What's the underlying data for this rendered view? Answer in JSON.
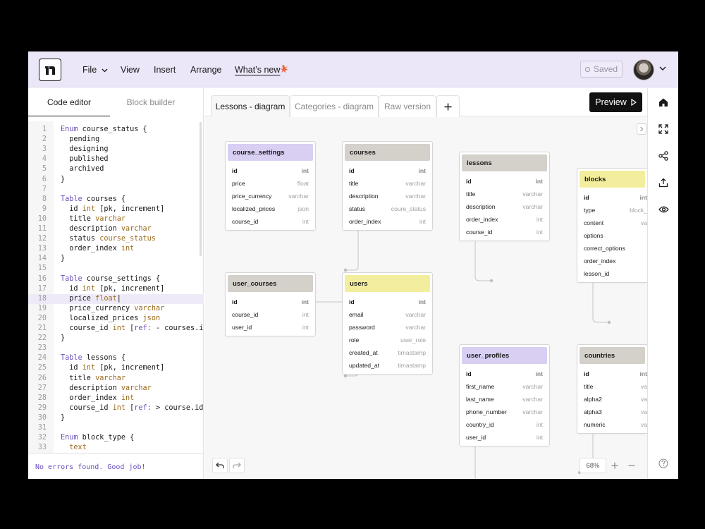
{
  "menu": {
    "file": "File",
    "view": "View",
    "insert": "Insert",
    "arrange": "Arrange",
    "whats_new": "What’s new"
  },
  "status_button": "Saved",
  "left_tabs": {
    "code": "Code editor",
    "block": "Block builder"
  },
  "code_lines": [
    [
      [
        "kw",
        "Enum"
      ],
      [
        "t",
        " course_status {"
      ]
    ],
    [
      [
        "t",
        "  pending"
      ]
    ],
    [
      [
        "t",
        "  designing"
      ]
    ],
    [
      [
        "t",
        "  published"
      ]
    ],
    [
      [
        "t",
        "  archived"
      ]
    ],
    [
      [
        "t",
        "}"
      ]
    ],
    [
      [
        "t",
        ""
      ]
    ],
    [
      [
        "kw",
        "Table"
      ],
      [
        "t",
        " courses {"
      ]
    ],
    [
      [
        "t",
        "  id "
      ],
      [
        "ty",
        "int"
      ],
      [
        "t",
        " [pk, increment]"
      ]
    ],
    [
      [
        "t",
        "  title "
      ],
      [
        "ty",
        "varchar"
      ]
    ],
    [
      [
        "t",
        "  description "
      ],
      [
        "ty",
        "varchar"
      ]
    ],
    [
      [
        "t",
        "  status "
      ],
      [
        "ty",
        "course_status"
      ]
    ],
    [
      [
        "t",
        "  order_index "
      ],
      [
        "ty",
        "int"
      ]
    ],
    [
      [
        "t",
        "}"
      ]
    ],
    [
      [
        "t",
        ""
      ]
    ],
    [
      [
        "kw",
        "Table"
      ],
      [
        "t",
        " course_settings {"
      ]
    ],
    [
      [
        "t",
        "  id "
      ],
      [
        "ty",
        "int"
      ],
      [
        "t",
        " [pk, increment]"
      ]
    ],
    [
      [
        "t",
        "  price "
      ],
      [
        "ty",
        "float"
      ],
      [
        "t",
        "|"
      ]
    ],
    [
      [
        "t",
        "  price_currency "
      ],
      [
        "ty",
        "varchar"
      ]
    ],
    [
      [
        "t",
        "  localized_prices "
      ],
      [
        "ty",
        "json"
      ]
    ],
    [
      [
        "t",
        "  course_id "
      ],
      [
        "ty",
        "int"
      ],
      [
        "t",
        " ["
      ],
      [
        "rf",
        "ref:"
      ],
      [
        "t",
        " - courses.id]"
      ]
    ],
    [
      [
        "t",
        "}"
      ]
    ],
    [
      [
        "t",
        ""
      ]
    ],
    [
      [
        "kw",
        "Table"
      ],
      [
        "t",
        " lessons {"
      ]
    ],
    [
      [
        "t",
        "  id "
      ],
      [
        "ty",
        "int"
      ],
      [
        "t",
        " [pk, increment]"
      ]
    ],
    [
      [
        "t",
        "  title "
      ],
      [
        "ty",
        "varchar"
      ]
    ],
    [
      [
        "t",
        "  description "
      ],
      [
        "ty",
        "varchar"
      ]
    ],
    [
      [
        "t",
        "  order_index "
      ],
      [
        "ty",
        "int"
      ]
    ],
    [
      [
        "t",
        "  course_id "
      ],
      [
        "ty",
        "int"
      ],
      [
        "t",
        " ["
      ],
      [
        "rf",
        "ref:"
      ],
      [
        "t",
        " > course.id]"
      ]
    ],
    [
      [
        "t",
        "}"
      ]
    ],
    [
      [
        "t",
        ""
      ]
    ],
    [
      [
        "kw",
        "Enum"
      ],
      [
        "t",
        " block_type {"
      ]
    ],
    [
      [
        "t",
        "  "
      ],
      [
        "ty",
        "text"
      ]
    ]
  ],
  "highlight_line": 18,
  "status_message": "No errors found. Good job!",
  "canvas_tabs": [
    "Lessons - diagram",
    "Categories - diagram",
    "Raw version"
  ],
  "preview_label": "Preview",
  "zoom": "68%",
  "colors": {
    "purple": "#d8cff3",
    "grey": "#d4d0ca",
    "yellow": "#f3ee9e",
    "topbar": "#ebe6f8"
  },
  "tables": [
    {
      "name": "course_settings",
      "color": "purple",
      "fields": [
        [
          "id",
          "int",
          true
        ],
        [
          "price",
          "float"
        ],
        [
          "price_currency",
          "varchar"
        ],
        [
          "localized_prices",
          "json"
        ],
        [
          "course_id",
          "int"
        ]
      ]
    },
    {
      "name": "courses",
      "color": "grey",
      "fields": [
        [
          "id",
          "int",
          true
        ],
        [
          "title",
          "varchar"
        ],
        [
          "description",
          "varchar"
        ],
        [
          "status",
          "coure_status"
        ],
        [
          "order_index",
          "int"
        ]
      ]
    },
    {
      "name": "lessons",
      "color": "grey",
      "fields": [
        [
          "id",
          "int",
          true
        ],
        [
          "title",
          "varchar"
        ],
        [
          "description",
          "varchar"
        ],
        [
          "order_index",
          "int"
        ],
        [
          "course_id",
          "int"
        ]
      ]
    },
    {
      "name": "blocks",
      "color": "yellow",
      "fields": [
        [
          "id",
          "int",
          true
        ],
        [
          "type",
          "block_"
        ],
        [
          "content",
          "va"
        ],
        [
          "options",
          ""
        ],
        [
          "correct_options",
          ""
        ],
        [
          "order_index",
          ""
        ],
        [
          "lesson_id",
          ""
        ]
      ]
    },
    {
      "name": "user_courses",
      "color": "grey",
      "fields": [
        [
          "id",
          "int",
          true
        ],
        [
          "course_id",
          "int"
        ],
        [
          "user_id",
          "int"
        ]
      ]
    },
    {
      "name": "users",
      "color": "yellow",
      "fields": [
        [
          "id",
          "int",
          true
        ],
        [
          "email",
          "varchar"
        ],
        [
          "password",
          "varchar"
        ],
        [
          "role",
          "user_role"
        ],
        [
          "created_at",
          "timastamp"
        ],
        [
          "updated_at",
          "timastamp"
        ]
      ]
    },
    {
      "name": "user_profiles",
      "color": "purple",
      "fields": [
        [
          "id",
          "int",
          true
        ],
        [
          "first_name",
          "varchar"
        ],
        [
          "last_name",
          "varchar"
        ],
        [
          "phone_number",
          "varchar"
        ],
        [
          "country_id",
          "int"
        ],
        [
          "user_id",
          "int"
        ]
      ]
    },
    {
      "name": "countries",
      "color": "grey",
      "fields": [
        [
          "id",
          "int",
          true
        ],
        [
          "title",
          "va"
        ],
        [
          "alpha2",
          "va"
        ],
        [
          "alpha3",
          "va"
        ],
        [
          "numeric",
          "va"
        ]
      ]
    }
  ]
}
